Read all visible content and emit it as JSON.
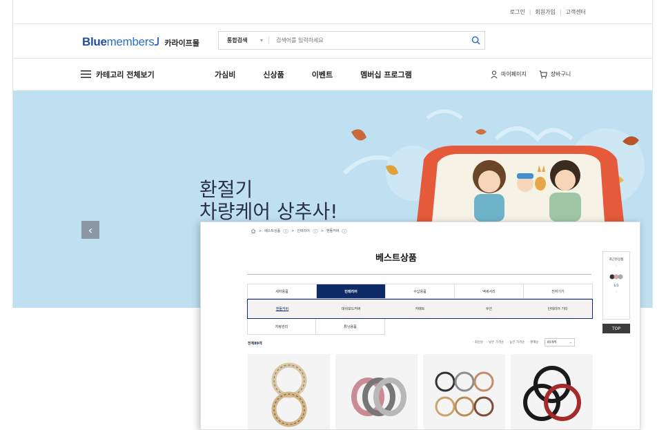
{
  "back": {
    "util_links": [
      "로그인",
      "회원가입",
      "고객센터"
    ],
    "logo": {
      "bold": "Blue",
      "light": "members",
      "mall": "카라이프몰"
    },
    "search": {
      "category": "통합검색",
      "placeholder": "검색어를 입력하세요"
    },
    "gnb": {
      "all_label": "카테고리 전체보기",
      "menu": [
        "가심비",
        "신상품",
        "이벤트",
        "멤버십 프로그램"
      ],
      "mypage": "마이페이지",
      "cart": "장바구니"
    },
    "hero": {
      "line1": "환절기",
      "line2": "차량케어 상추사!"
    }
  },
  "front": {
    "breadcrumb": [
      "베스트상품",
      "인테리어",
      "핸들커버"
    ],
    "title": "베스트상품",
    "categories": [
      "세차용품",
      "인테리어",
      "수납용품",
      "액세서리",
      "전자기기"
    ],
    "active_category": 1,
    "subcategories": [
      "핸들커버",
      "대쉬보드커버",
      "카매트",
      "쿠션",
      "인테리어 기타"
    ],
    "subcategories2": [
      "차량관리",
      "튜닝용품"
    ],
    "total_label": "전체",
    "total_count": "89",
    "total_unit": "개",
    "sort_options": [
      "최신순",
      "낮은 가격순",
      "높은 가격순",
      "판매순"
    ],
    "page_size": "40개씩",
    "side": {
      "recent_label": "최근본상품",
      "page": "1/1",
      "top": "TOP"
    }
  },
  "colors": {
    "navy": "#0f2b66",
    "brand_blue": "#1f4e96",
    "hero_bg": "#bfe0f1"
  }
}
